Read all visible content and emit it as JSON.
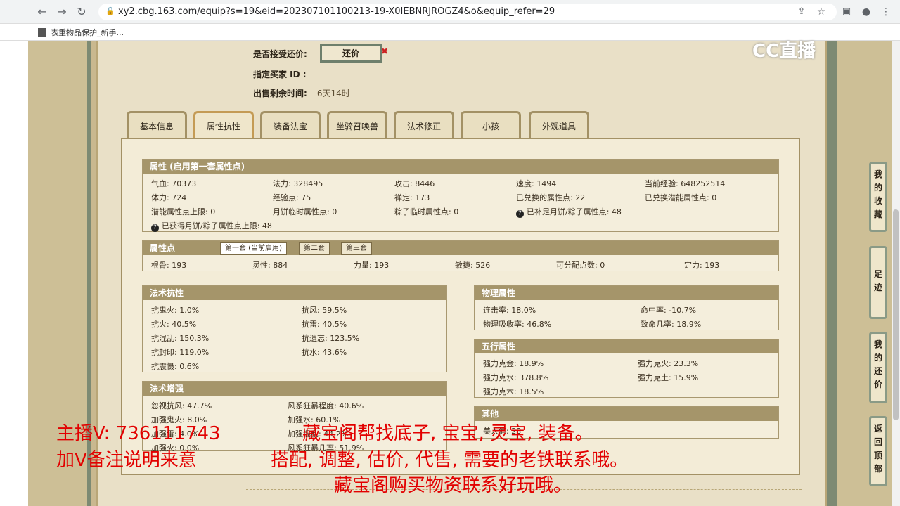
{
  "browser": {
    "url": "xy2.cbg.163.com/equip?s=19&eid=202307101100213-19-X0IEBNRJROGZ4&o&equip_refer=29",
    "bookmark": "表重物品保护_新手..."
  },
  "top_info": {
    "accept_counter_label": "是否接受还价:",
    "counter_button": "还价",
    "designated_buyer_label": "指定买家 ID :",
    "time_left_label": "出售剩余时间:",
    "time_left_value": "6天14时"
  },
  "tabs": [
    "基本信息",
    "属性抗性",
    "装备法宝",
    "坐骑召唤兽",
    "法术修正",
    "小孩",
    "外观道具"
  ],
  "attributes": {
    "title": "属性 (启用第一套属性点)",
    "rows": [
      [
        "气血: 70373",
        "法力: 328495",
        "攻击: 8446",
        "速度: 1494",
        "当前经验: 648252514"
      ],
      [
        "体力: 724",
        "经验点: 75",
        "禅定: 173",
        "已兑换的属性点: 22",
        "已兑换潜能属性点: 0"
      ],
      [
        "潜能属性点上限: 0",
        "月饼临时属性点: 0",
        "粽子临时属性点: 0",
        "已补足月饼/粽子属性点: 48"
      ]
    ],
    "last": "已获得月饼/粽子属性点上限: 48",
    "q_icon": "?"
  },
  "points": {
    "title": "属性点",
    "subtabs": [
      "第一套 (当前启用)",
      "第二套",
      "第三套"
    ],
    "values": [
      "根骨: 193",
      "灵性: 884",
      "力量: 193",
      "敏捷: 526",
      "可分配点数: 0",
      "定力: 193"
    ]
  },
  "resist": {
    "title": "法术抗性",
    "rows": [
      [
        "抗鬼火: 1.0%",
        "抗风: 59.5%"
      ],
      [
        "抗火: 40.5%",
        "抗雷: 40.5%"
      ],
      [
        "抗混乱: 150.3%",
        "抗遗忘: 123.5%"
      ],
      [
        "抗封印: 119.0%",
        "抗水: 43.6%"
      ],
      [
        "抗震慑: 0.6%"
      ]
    ]
  },
  "enhance": {
    "title": "法术增强",
    "rows": [
      [
        "忽视抗风: 47.7%",
        "风系狂暴程度: 40.6%"
      ],
      [
        "加强鬼火: 8.0%",
        "加强水: 60.1%"
      ],
      [
        "加强雷: 4.0%",
        "加强混乱: 44.2%"
      ],
      [
        "加强火: 0.0%",
        "风系狂暴几率: 51.9%"
      ]
    ]
  },
  "physical": {
    "title": "物理属性",
    "rows": [
      [
        "连击率: 18.0%",
        "命中率: -10.7%"
      ],
      [
        "物理吸收率: 46.8%",
        "致命几率: 18.9%"
      ]
    ]
  },
  "elements": {
    "title": "五行属性",
    "rows": [
      [
        "强力克金: 18.9%",
        "强力克火: 23.3%"
      ],
      [
        "强力克水: 378.8%",
        "强力克土: 15.9%"
      ],
      [
        "强力克木: 18.5%"
      ]
    ]
  },
  "other": {
    "title": "其他",
    "row": "美人值: 28"
  },
  "side_buttons": [
    [
      "我",
      "的",
      "收",
      "藏"
    ],
    [
      "足",
      "迹"
    ],
    [
      "我",
      "的",
      "还",
      "价"
    ],
    [
      "返",
      "回",
      "顶",
      "部"
    ]
  ],
  "watermark": "CC直播",
  "overlay": {
    "line1a": "主播V: 736111743",
    "line1b": "藏宝阁帮找底子, 宝宝, 灵宝, 装备。",
    "line2a": "加V备注说明来意",
    "line2b": "搭配, 调整, 估价, 代售, 需要的老铁联系哦。",
    "line3": "藏宝阁购买物资联系好玩哦。"
  }
}
